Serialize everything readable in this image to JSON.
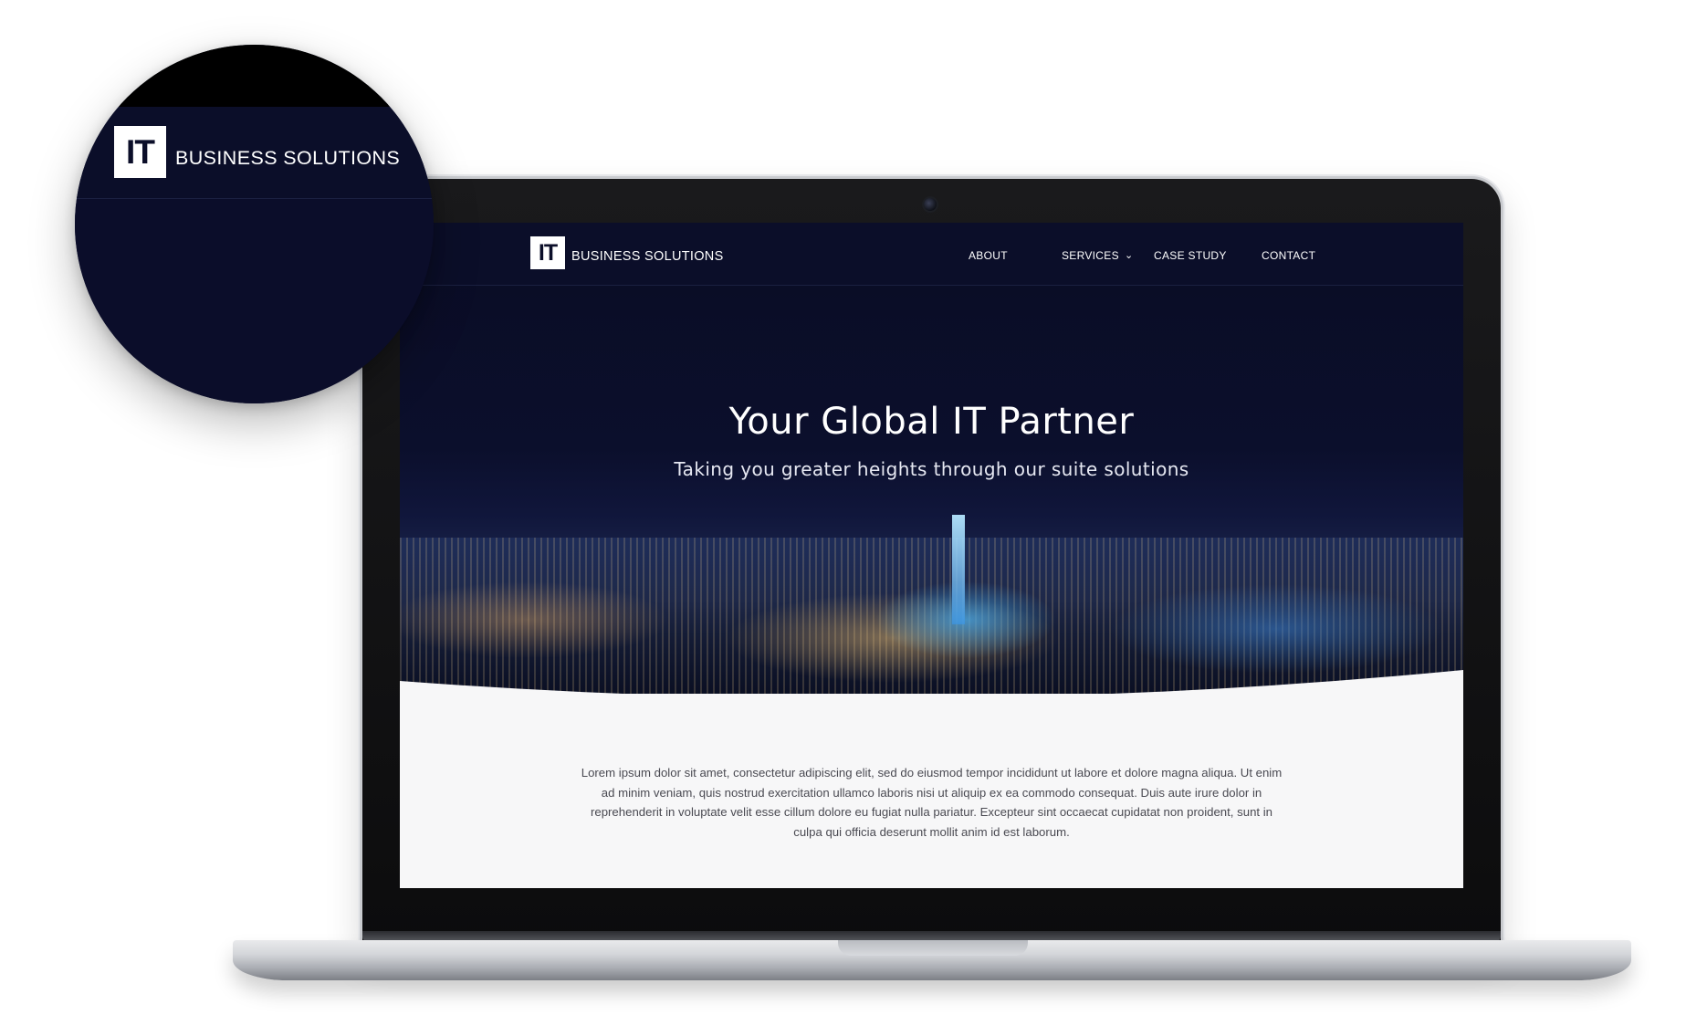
{
  "brand": {
    "logo_mark": "IT",
    "logo_text": "BUSINESS SOLUTIONS"
  },
  "nav": {
    "items": [
      {
        "label": "ABOUT"
      },
      {
        "label": "SERVICES",
        "icon": "chevron-down-icon"
      },
      {
        "label": "CASE STUDY"
      },
      {
        "label": "CONTACT"
      }
    ]
  },
  "hero": {
    "title": "Your Global IT Partner",
    "subtitle": "Taking you greater heights through our suite solutions"
  },
  "content": {
    "paragraph": "Lorem ipsum dolor sit amet, consectetur adipiscing elit, sed do eiusmod tempor incididunt ut labore et dolore magna aliqua. Ut enim ad minim veniam, quis nostrud exercitation ullamco laboris nisi ut aliquip ex ea commodo consequat. Duis aute irure dolor in reprehenderit in voluptate velit esse cillum dolore eu fugiat nulla pariatur. Excepteur sint occaecat cupidatat non proident, sunt in culpa qui officia deserunt mollit anim id est laborum."
  },
  "colors": {
    "navy": "#0b0e29",
    "page_bg": "#f7f7f8",
    "text": "#4a4a52",
    "white": "#ffffff"
  }
}
